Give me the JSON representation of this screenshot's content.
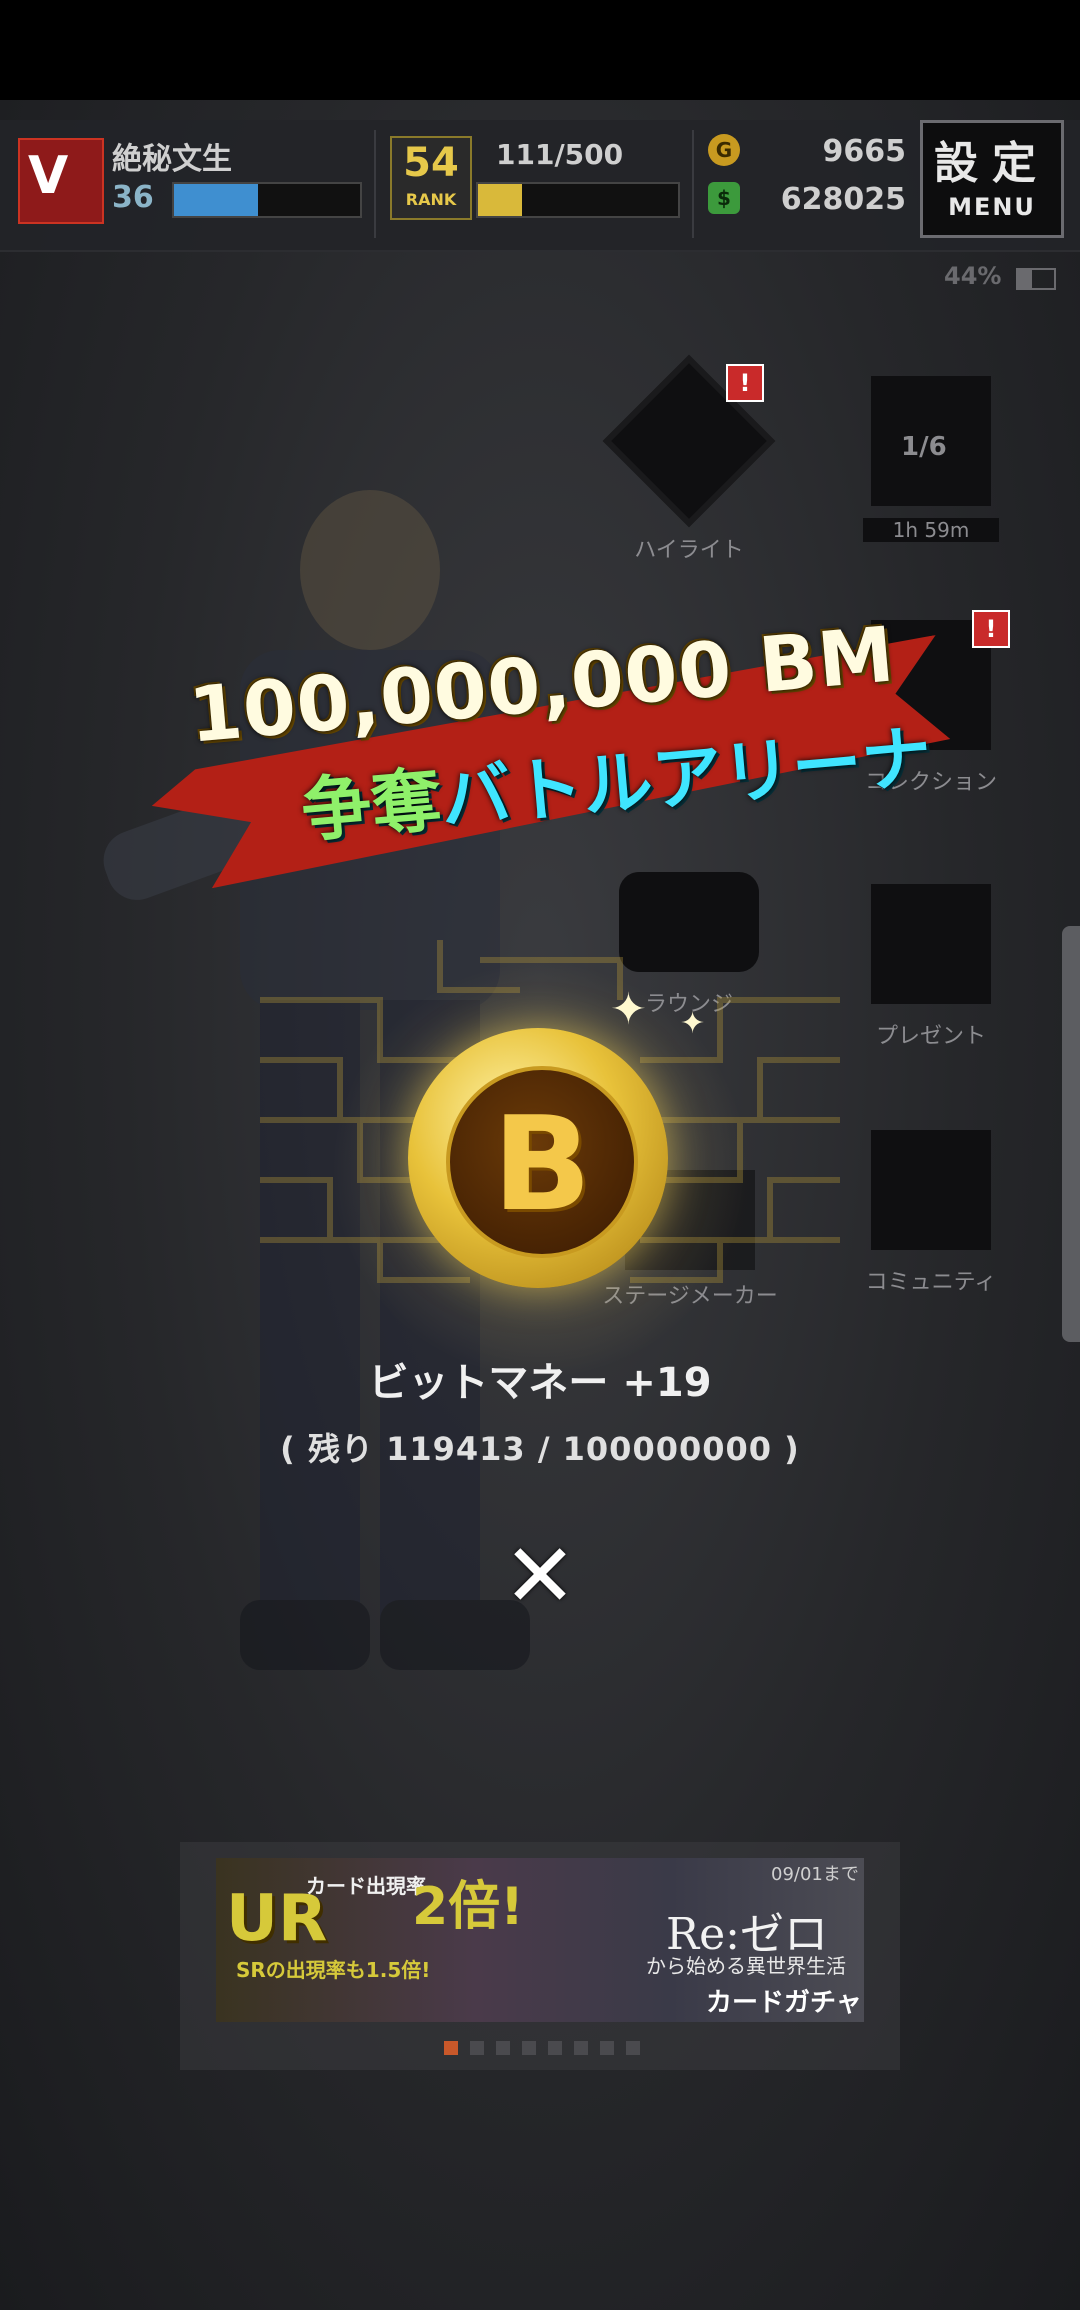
{
  "header": {
    "player_name": "絶秘文生",
    "player_level": "36",
    "player_exp_fraction": 0.45,
    "rank_value": "54",
    "rank_label": "RANK",
    "stamina": "111/500",
    "stamina_fraction": 0.22,
    "currency_gold": "9665",
    "currency_green": "628025",
    "menu_kanji": "設定",
    "menu_label": "MENU",
    "battery": "44%"
  },
  "menu": {
    "highlight_label": "ハイライト",
    "timer_label": "1h 59m",
    "counter_label": "1/6",
    "collection_label": "コレクション",
    "community_chat_label": "ラウンジ",
    "present_label": "プレゼント",
    "stage_maker_label": "ステージメーカー",
    "community_label": "コミュニティ",
    "notify_mark": "!"
  },
  "popup": {
    "title_line1": "100,000,000 BM",
    "title_line2_a": "争奪",
    "title_line2_b": "バトルアリーナ",
    "coin_letter": "B",
    "reward_text": "ビットマネー +19",
    "remaining_text": "( 残り 119413 / 100000000 )",
    "close_symbol": "✕"
  },
  "banner": {
    "ur": "UR",
    "line_a": "カード出現率",
    "line_b": "2倍!",
    "line_c": "SRの出現率も1.5倍!",
    "re_zero": "Re:ゼロ",
    "subtitle": "から始める異世界生活",
    "gacha": "カードガチャ",
    "date": "09/01まで",
    "dot_count": 8,
    "active_dot": 0
  },
  "colors": {
    "ribbon": "#b32016",
    "coin_gold": "#e8c23a",
    "accent_green": "#8ff06a",
    "accent_cyan": "#3fe5ff"
  }
}
